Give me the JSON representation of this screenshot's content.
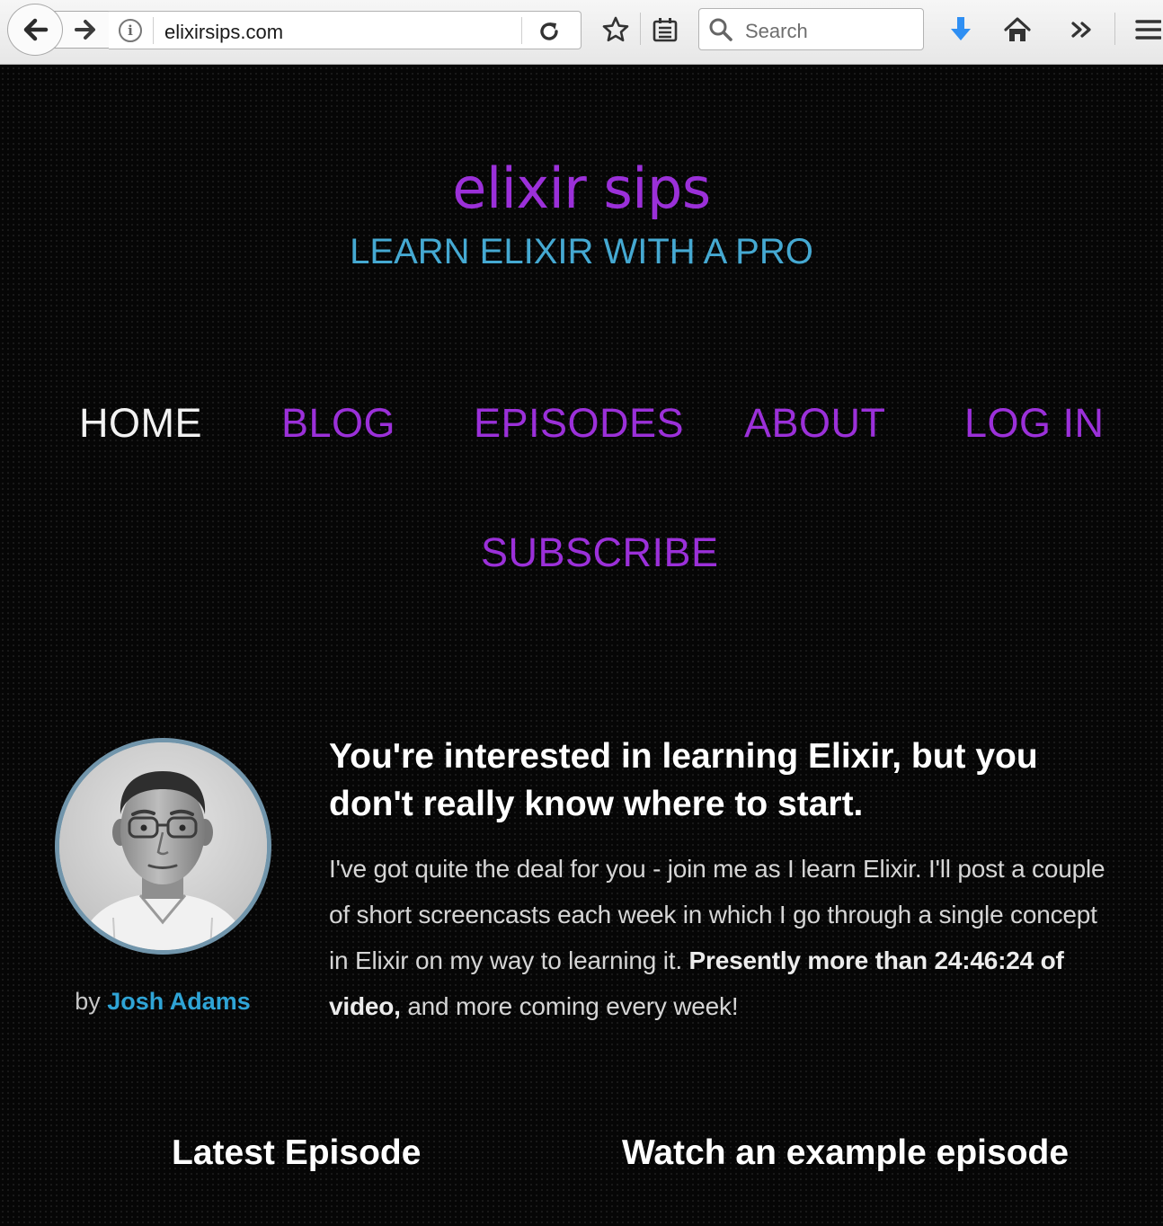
{
  "browser": {
    "url": "elixirsips.com",
    "search_placeholder": "Search",
    "download_color": "#2f8ff3"
  },
  "site": {
    "title": "elixir sips",
    "tagline": "LEARN ELIXIR WITH A PRO",
    "title_color": "#9b30d9",
    "tagline_color": "#45a9d2"
  },
  "nav": {
    "home": "HOME",
    "blog": "BLOG",
    "episodes": "EPISODES",
    "about": "ABOUT",
    "login": "LOG IN",
    "subscribe": "SUBSCRIBE",
    "active": "HOME"
  },
  "author": {
    "by": "by",
    "name": "Josh Adams"
  },
  "intro": {
    "heading": "You're interested in learning Elixir, but you don't really know where to start.",
    "body_start": "I've got quite the deal for you - join me as I learn Elixir. I'll post a couple of short screencasts each week in which I go through a single concept in Elixir on my way to learning it.",
    "body_bold": "Presently more than 24:46:24 of video,",
    "body_end": "and more coming every week!"
  },
  "sections": {
    "latest": "Latest Episode",
    "example": "Watch an example episode"
  }
}
